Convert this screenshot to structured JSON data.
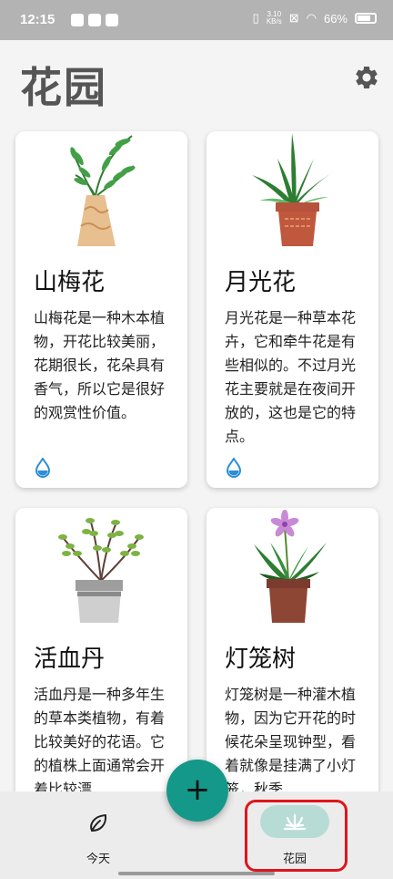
{
  "status_bar": {
    "time": "12:15",
    "net_speed_top": "3.10",
    "net_speed_bottom": "KB/s",
    "battery": "66%"
  },
  "header": {
    "title": "花园",
    "settings_icon": "gear-icon"
  },
  "plants": [
    {
      "name": "山梅花",
      "description": "山梅花是一种木本植物，开花比较美丽，花期很长，花朵具有香气，所以它是很好的观赏性价值。",
      "water_icon": "water-drop-icon"
    },
    {
      "name": "月光花",
      "description": "月光花是一种草本花卉，它和牵牛花是有些相似的。不过月光花主要就是在夜间开放的，这也是它的特点。",
      "water_icon": "water-drop-icon"
    },
    {
      "name": "活血丹",
      "description": "活血丹是一种多年生的草本类植物，有着比较美好的花语。它的植株上面通常会开着比较漂"
    },
    {
      "name": "灯笼树",
      "description": "灯笼树是一种灌木植物，因为它开花的时候花朵呈现钟型，看着就像是挂满了小灯笼，秋季"
    }
  ],
  "fab": {
    "label": "+"
  },
  "bottom_nav": {
    "items": [
      {
        "label": "今天",
        "icon": "leaf-icon"
      },
      {
        "label": "花园",
        "icon": "garden-sprout-icon",
        "selected": true
      }
    ]
  },
  "colors": {
    "accent": "#14988a",
    "selected_pill": "#b7dcd6",
    "highlight": "#e0141c",
    "water": "#2a8fd6"
  }
}
